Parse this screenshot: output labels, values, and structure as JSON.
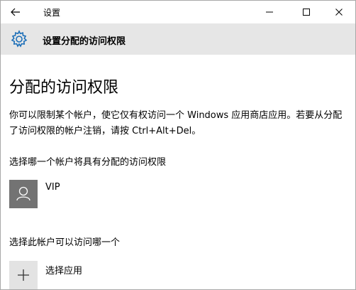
{
  "window": {
    "title": "设置"
  },
  "header": {
    "title": "设置分配的访问权限"
  },
  "main": {
    "page_title": "分配的访问权限",
    "description": "你可以限制某个帐户，使它仅有权访问一个 Windows 应用商店应用。若要从分配了访问权限的帐户注销，请按 Ctrl+Alt+Del。",
    "choose_account_label": "选择哪一个帐户将具有分配的访问权限",
    "account": {
      "name": "VIP"
    },
    "choose_app_label": "选择此帐户可以访问哪一个",
    "choose_app_button": "选择应用"
  },
  "icons": {
    "back": "back-arrow-icon",
    "minimize": "minimize-icon",
    "maximize": "maximize-icon",
    "close": "close-icon",
    "settings": "gear-icon",
    "user": "user-icon",
    "add": "plus-icon"
  },
  "colors": {
    "accent": "#1c6fb8",
    "header_bg": "#e6e6e6",
    "avatar_bg": "#737373"
  }
}
